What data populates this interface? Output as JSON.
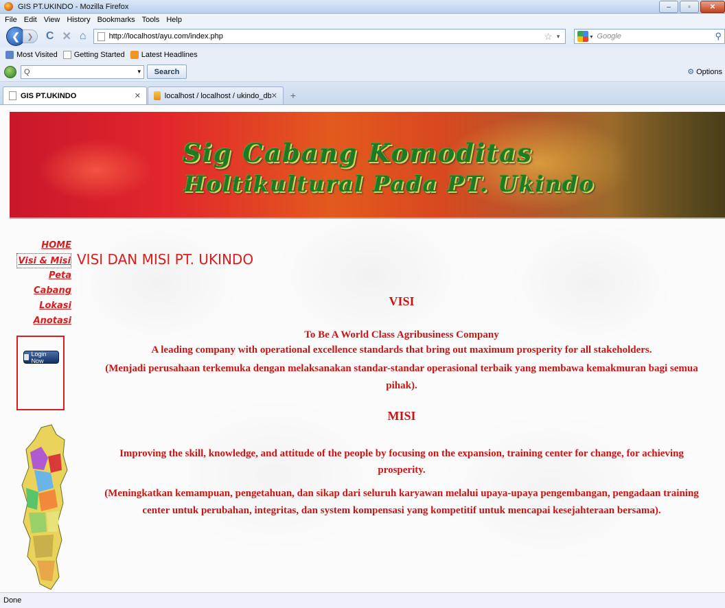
{
  "window": {
    "title": "GIS PT.UKINDO - Mozilla Firefox",
    "buttons": {
      "minimize": "–",
      "maximize": "▫",
      "close": "✕"
    }
  },
  "menubar": [
    "File",
    "Edit",
    "View",
    "History",
    "Bookmarks",
    "Tools",
    "Help"
  ],
  "navbar": {
    "url": "http://localhost/ayu.com/index.php",
    "search_placeholder": "Google"
  },
  "bookmarks": [
    "Most Visited",
    "Getting Started",
    "Latest Headlines"
  ],
  "toolbar2": {
    "search_value": "Q",
    "search_button": "Search",
    "options": "Options"
  },
  "tabs": [
    {
      "label": "GIS PT.UKINDO",
      "active": true
    },
    {
      "label": "localhost / localhost / ukindo_db / ...",
      "active": false
    }
  ],
  "page": {
    "banner": {
      "line1": "Sig Cabang Komoditas",
      "line2": "Holtikultural Pada PT. Ukindo"
    },
    "menu": [
      "HOME",
      "Visi & Misi",
      "Peta",
      "Cabang",
      "Lokasi",
      "Anotasi"
    ],
    "login_button": "Login Now",
    "heading": "VISI DAN MISI PT. UKINDO",
    "visi": {
      "title": "VISI",
      "line1": "To Be A World Class Agribusiness Company",
      "line2": "A leading company with operational excellence standards that bring out maximum prosperity for all stakeholders.",
      "line3": "(Menjadi perusahaan terkemuka dengan melaksanakan standar-standar operasional terbaik yang membawa kemakmuran bagi semua",
      "line4": "pihak)."
    },
    "misi": {
      "title": "MISI",
      "line1": "Improving the skill, knowledge, and attitude of the people by focusing on the expansion, training center for change, for achieving",
      "line2": "prosperity.",
      "line3": "(Meningkatkan kemampuan, pengetahuan, dan sikap dari seluruh karyawan melalui upaya-upaya pengembangan, pengadaan training",
      "line4": "center untuk perubahan, integritas, dan system kompensasi yang kompetitif untuk mencapai kesejahteraan bersama)."
    }
  },
  "status": "Done",
  "colors": {
    "accent_red": "#c81414",
    "banner_green": "#1f7a24"
  }
}
